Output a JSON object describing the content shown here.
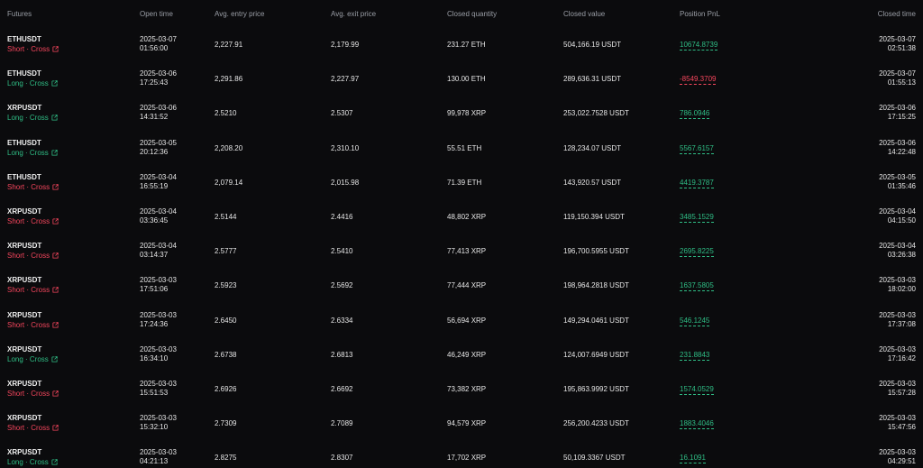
{
  "colors": {
    "background": "#0b0b0d",
    "header_text": "#9a9ea6",
    "long": "#2fbd85",
    "short": "#f6465d",
    "profit": "#2fbd85",
    "loss": "#f6465d"
  },
  "header": {
    "futures": "Futures",
    "open_time": "Open time",
    "avg_entry": "Avg. entry price",
    "avg_exit": "Avg. exit price",
    "closed_qty": "Closed quantity",
    "closed_value": "Closed value",
    "position_pnl": "Position PnL",
    "closed_time": "Closed time"
  },
  "rows": [
    {
      "symbol": "ETHUSDT",
      "side": "Short · Cross",
      "side_type": "short",
      "open_date": "2025-03-07",
      "open_time": "01:56:00",
      "entry": "2,227.91",
      "exit": "2,179.99",
      "qty": "231.27 ETH",
      "value": "504,166.19 USDT",
      "pnl": "10674.8739",
      "pnl_sign": "pos",
      "close_date": "2025-03-07",
      "close_time": "02:51:38",
      "icon": "external-link-icon"
    },
    {
      "symbol": "ETHUSDT",
      "side": "Long · Cross",
      "side_type": "long",
      "open_date": "2025-03-06",
      "open_time": "17:25:43",
      "entry": "2,291.86",
      "exit": "2,227.97",
      "qty": "130.00 ETH",
      "value": "289,636.31 USDT",
      "pnl": "-8549.3709",
      "pnl_sign": "neg",
      "close_date": "2025-03-07",
      "close_time": "01:55:13",
      "icon": "external-link-icon"
    },
    {
      "symbol": "XRPUSDT",
      "side": "Long · Cross",
      "side_type": "long",
      "open_date": "2025-03-06",
      "open_time": "14:31:52",
      "entry": "2.5210",
      "exit": "2.5307",
      "qty": "99,978 XRP",
      "value": "253,022.7528 USDT",
      "pnl": "786.0946",
      "pnl_sign": "pos",
      "close_date": "2025-03-06",
      "close_time": "17:15:25",
      "icon": "external-link-icon"
    },
    {
      "symbol": "ETHUSDT",
      "side": "Long · Cross",
      "side_type": "long",
      "open_date": "2025-03-05",
      "open_time": "20:12:36",
      "entry": "2,208.20",
      "exit": "2,310.10",
      "qty": "55.51 ETH",
      "value": "128,234.07 USDT",
      "pnl": "5567.6157",
      "pnl_sign": "pos",
      "close_date": "2025-03-06",
      "close_time": "14:22:48",
      "icon": "external-link-icon"
    },
    {
      "symbol": "ETHUSDT",
      "side": "Short · Cross",
      "side_type": "short",
      "open_date": "2025-03-04",
      "open_time": "16:55:19",
      "entry": "2,079.14",
      "exit": "2,015.98",
      "qty": "71.39 ETH",
      "value": "143,920.57 USDT",
      "pnl": "4419.3787",
      "pnl_sign": "pos",
      "close_date": "2025-03-05",
      "close_time": "01:35:46",
      "icon": "external-link-icon"
    },
    {
      "symbol": "XRPUSDT",
      "side": "Short · Cross",
      "side_type": "short",
      "open_date": "2025-03-04",
      "open_time": "03:36:45",
      "entry": "2.5144",
      "exit": "2.4416",
      "qty": "48,802 XRP",
      "value": "119,150.394 USDT",
      "pnl": "3485.1529",
      "pnl_sign": "pos",
      "close_date": "2025-03-04",
      "close_time": "04:15:50",
      "icon": "external-link-icon"
    },
    {
      "symbol": "XRPUSDT",
      "side": "Short · Cross",
      "side_type": "short",
      "open_date": "2025-03-04",
      "open_time": "03:14:37",
      "entry": "2.5777",
      "exit": "2.5410",
      "qty": "77,413 XRP",
      "value": "196,700.5955 USDT",
      "pnl": "2695.8225",
      "pnl_sign": "pos",
      "close_date": "2025-03-04",
      "close_time": "03:26:38",
      "icon": "external-link-icon"
    },
    {
      "symbol": "XRPUSDT",
      "side": "Short · Cross",
      "side_type": "short",
      "open_date": "2025-03-03",
      "open_time": "17:51:06",
      "entry": "2.5923",
      "exit": "2.5692",
      "qty": "77,444 XRP",
      "value": "198,964.2818 USDT",
      "pnl": "1637.5805",
      "pnl_sign": "pos",
      "close_date": "2025-03-03",
      "close_time": "18:02:00",
      "icon": "external-link-icon"
    },
    {
      "symbol": "XRPUSDT",
      "side": "Short · Cross",
      "side_type": "short",
      "open_date": "2025-03-03",
      "open_time": "17:24:36",
      "entry": "2.6450",
      "exit": "2.6334",
      "qty": "56,694 XRP",
      "value": "149,294.0461 USDT",
      "pnl": "546.1245",
      "pnl_sign": "pos",
      "close_date": "2025-03-03",
      "close_time": "17:37:08",
      "icon": "external-link-icon"
    },
    {
      "symbol": "XRPUSDT",
      "side": "Long · Cross",
      "side_type": "long",
      "open_date": "2025-03-03",
      "open_time": "16:34:10",
      "entry": "2.6738",
      "exit": "2.6813",
      "qty": "46,249 XRP",
      "value": "124,007.6949 USDT",
      "pnl": "231.8843",
      "pnl_sign": "pos",
      "close_date": "2025-03-03",
      "close_time": "17:16:42",
      "icon": "external-link-icon"
    },
    {
      "symbol": "XRPUSDT",
      "side": "Short · Cross",
      "side_type": "short",
      "open_date": "2025-03-03",
      "open_time": "15:51:53",
      "entry": "2.6926",
      "exit": "2.6692",
      "qty": "73,382 XRP",
      "value": "195,863.9992 USDT",
      "pnl": "1574.0529",
      "pnl_sign": "pos",
      "close_date": "2025-03-03",
      "close_time": "15:57:28",
      "icon": "external-link-icon"
    },
    {
      "symbol": "XRPUSDT",
      "side": "Short · Cross",
      "side_type": "short",
      "open_date": "2025-03-03",
      "open_time": "15:32:10",
      "entry": "2.7309",
      "exit": "2.7089",
      "qty": "94,579 XRP",
      "value": "256,200.4233 USDT",
      "pnl": "1883.4046",
      "pnl_sign": "pos",
      "close_date": "2025-03-03",
      "close_time": "15:47:56",
      "icon": "external-link-icon"
    },
    {
      "symbol": "XRPUSDT",
      "side": "Long · Cross",
      "side_type": "long",
      "open_date": "2025-03-03",
      "open_time": "04:21:13",
      "entry": "2.8275",
      "exit": "2.8307",
      "qty": "17,702 XRP",
      "value": "50,109.3367 USDT",
      "pnl": "16.1091",
      "pnl_sign": "pos",
      "close_date": "2025-03-03",
      "close_time": "04:29:51",
      "icon": "external-link-icon"
    }
  ]
}
